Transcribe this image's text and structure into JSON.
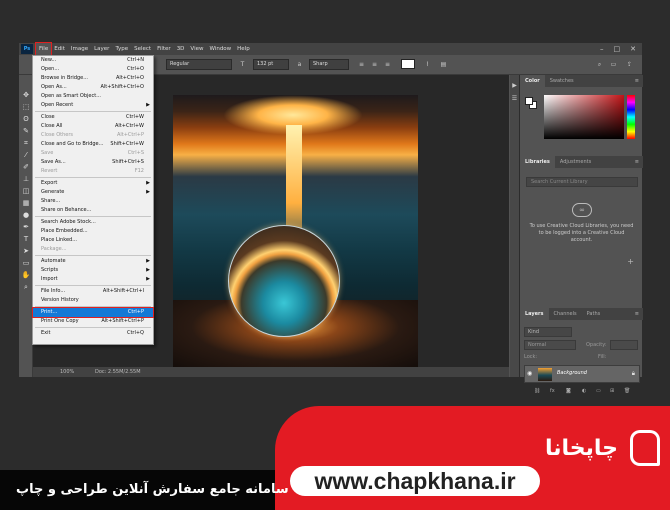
{
  "menubar": {
    "logo": "Ps",
    "items": [
      "File",
      "Edit",
      "Image",
      "Layer",
      "Type",
      "Select",
      "Filter",
      "3D",
      "View",
      "Window",
      "Help"
    ]
  },
  "options": {
    "font_style": "Regular",
    "font_size": "132 pt",
    "antialias": "Sharp"
  },
  "file_menu": [
    {
      "label": "New...",
      "shortcut": "Ctrl+N"
    },
    {
      "label": "Open...",
      "shortcut": "Ctrl+O"
    },
    {
      "label": "Browse in Bridge...",
      "shortcut": "Alt+Ctrl+O"
    },
    {
      "label": "Open As...",
      "shortcut": "Alt+Shift+Ctrl+O"
    },
    {
      "label": "Open as Smart Object...",
      "shortcut": ""
    },
    {
      "label": "Open Recent",
      "shortcut": "",
      "submenu": true
    },
    {
      "sep": true
    },
    {
      "label": "Close",
      "shortcut": "Ctrl+W"
    },
    {
      "label": "Close All",
      "shortcut": "Alt+Ctrl+W"
    },
    {
      "label": "Close Others",
      "shortcut": "Alt+Ctrl+P",
      "disabled": true
    },
    {
      "label": "Close and Go to Bridge...",
      "shortcut": "Shift+Ctrl+W"
    },
    {
      "label": "Save",
      "shortcut": "Ctrl+S",
      "disabled": true
    },
    {
      "label": "Save As...",
      "shortcut": "Shift+Ctrl+S"
    },
    {
      "label": "Revert",
      "shortcut": "F12",
      "disabled": true
    },
    {
      "sep": true
    },
    {
      "label": "Export",
      "shortcut": "",
      "submenu": true
    },
    {
      "label": "Generate",
      "shortcut": "",
      "submenu": true
    },
    {
      "label": "Share...",
      "shortcut": ""
    },
    {
      "label": "Share on Behance...",
      "shortcut": ""
    },
    {
      "sep": true
    },
    {
      "label": "Search Adobe Stock...",
      "shortcut": ""
    },
    {
      "label": "Place Embedded...",
      "shortcut": ""
    },
    {
      "label": "Place Linked...",
      "shortcut": ""
    },
    {
      "label": "Package...",
      "shortcut": "",
      "disabled": true
    },
    {
      "sep": true
    },
    {
      "label": "Automate",
      "shortcut": "",
      "submenu": true
    },
    {
      "label": "Scripts",
      "shortcut": "",
      "submenu": true
    },
    {
      "label": "Import",
      "shortcut": "",
      "submenu": true
    },
    {
      "sep": true
    },
    {
      "label": "File Info...",
      "shortcut": "Alt+Shift+Ctrl+I"
    },
    {
      "label": "Version History",
      "shortcut": ""
    },
    {
      "sep": true
    },
    {
      "label": "Print...",
      "shortcut": "Ctrl+P",
      "highlighted": true
    },
    {
      "label": "Print One Copy",
      "shortcut": "Alt+Shift+Ctrl+P"
    },
    {
      "sep": true
    },
    {
      "label": "Exit",
      "shortcut": "Ctrl+Q"
    }
  ],
  "status": {
    "zoom": "100%",
    "doc": "Doc: 2.55M/2.55M"
  },
  "panels": {
    "color_tabs": [
      "Color",
      "Swatches"
    ],
    "library_tabs": [
      "Libraries",
      "Adjustments"
    ],
    "library_search": "Search Current Library",
    "library_message": "To use Creative Cloud Libraries, you need to be logged into a Creative Cloud account.",
    "layer_tabs": [
      "Layers",
      "Channels",
      "Paths"
    ],
    "layer_filter": "Kind",
    "blend_mode": "Normal",
    "opacity_label": "Opacity:",
    "lock_label": "Lock:",
    "fill_label": "Fill:",
    "layer_name": "Background"
  },
  "banner": {
    "url": "www.chapkhana.ir",
    "tagline": "سامانه جامع سفارش آنلاین طراحی و چاپ",
    "brand": "چاپخانا"
  },
  "colors": {
    "accent": "#e31b23",
    "highlight": "#1479d6"
  }
}
